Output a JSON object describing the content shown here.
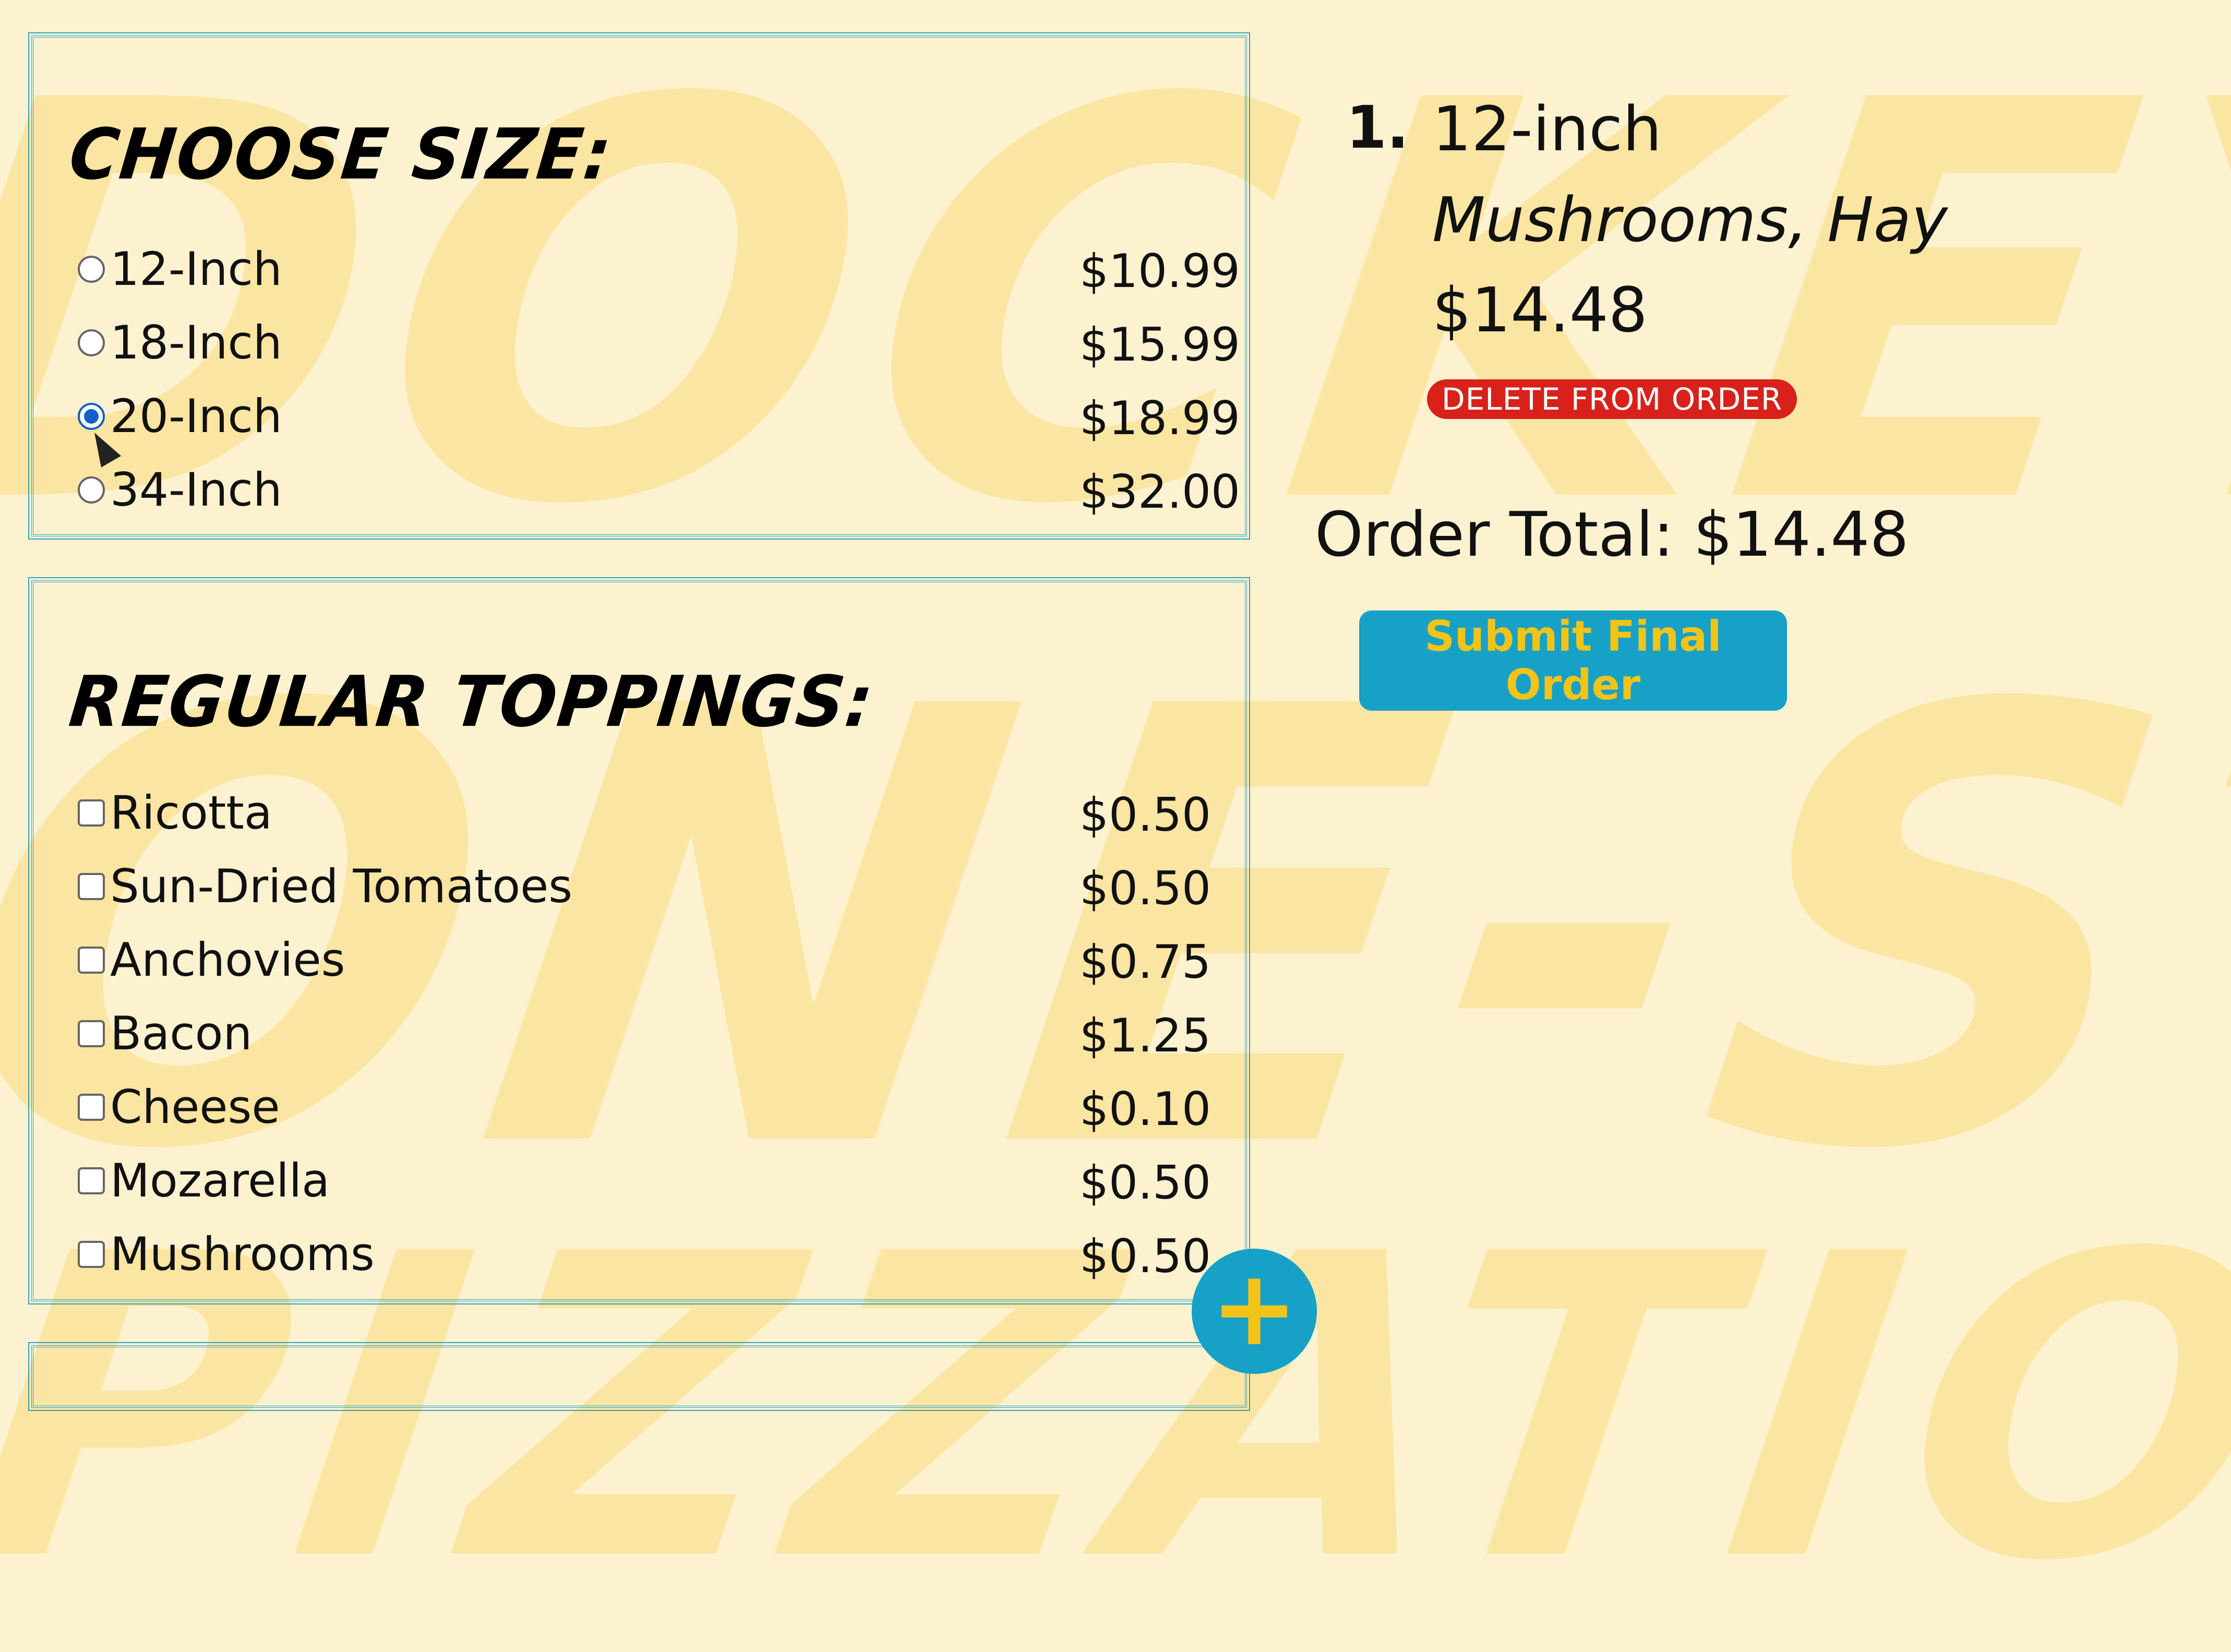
{
  "background": {
    "words": [
      "DOCKEY'S",
      "ONE-STOP",
      "PIZZATION"
    ]
  },
  "size_panel": {
    "title": "CHOOSE SIZE:",
    "options": [
      {
        "label": "12-Inch",
        "price": "$10.99",
        "checked": false
      },
      {
        "label": "18-Inch",
        "price": "$15.99",
        "checked": false
      },
      {
        "label": "20-Inch",
        "price": "$18.99",
        "checked": true
      },
      {
        "label": "34-Inch",
        "price": "$32.00",
        "checked": false
      }
    ]
  },
  "toppings_panel": {
    "title": "REGULAR TOPPINGS:",
    "options": [
      {
        "label": "Ricotta",
        "price": "$0.50",
        "checked": false
      },
      {
        "label": "Sun-Dried Tomatoes",
        "price": "$0.50",
        "checked": false
      },
      {
        "label": "Anchovies",
        "price": "$0.75",
        "checked": false
      },
      {
        "label": "Bacon",
        "price": "$1.25",
        "checked": false
      },
      {
        "label": "Cheese",
        "price": "$0.10",
        "checked": false
      },
      {
        "label": "Mozarella",
        "price": "$0.50",
        "checked": false
      },
      {
        "label": "Mushrooms",
        "price": "$0.50",
        "checked": false
      }
    ]
  },
  "order": {
    "items": [
      {
        "number": "1.",
        "size": "12-inch",
        "toppings": "Mushrooms, Hay",
        "price": "$14.48",
        "delete_label": "DELETE FROM ORDER"
      }
    ],
    "total_label": "Order Total: $14.48",
    "submit_label": "Submit Final Order"
  },
  "fab": {
    "label": "+",
    "icon": "plus-icon"
  },
  "colors": {
    "background": "#fdf2d0",
    "watermark": "#fbe39a",
    "accent_blue": "#17a1c7",
    "accent_yellow": "#f2c418",
    "delete_red": "#d8211b",
    "panel_border": "#2aa4c4"
  }
}
